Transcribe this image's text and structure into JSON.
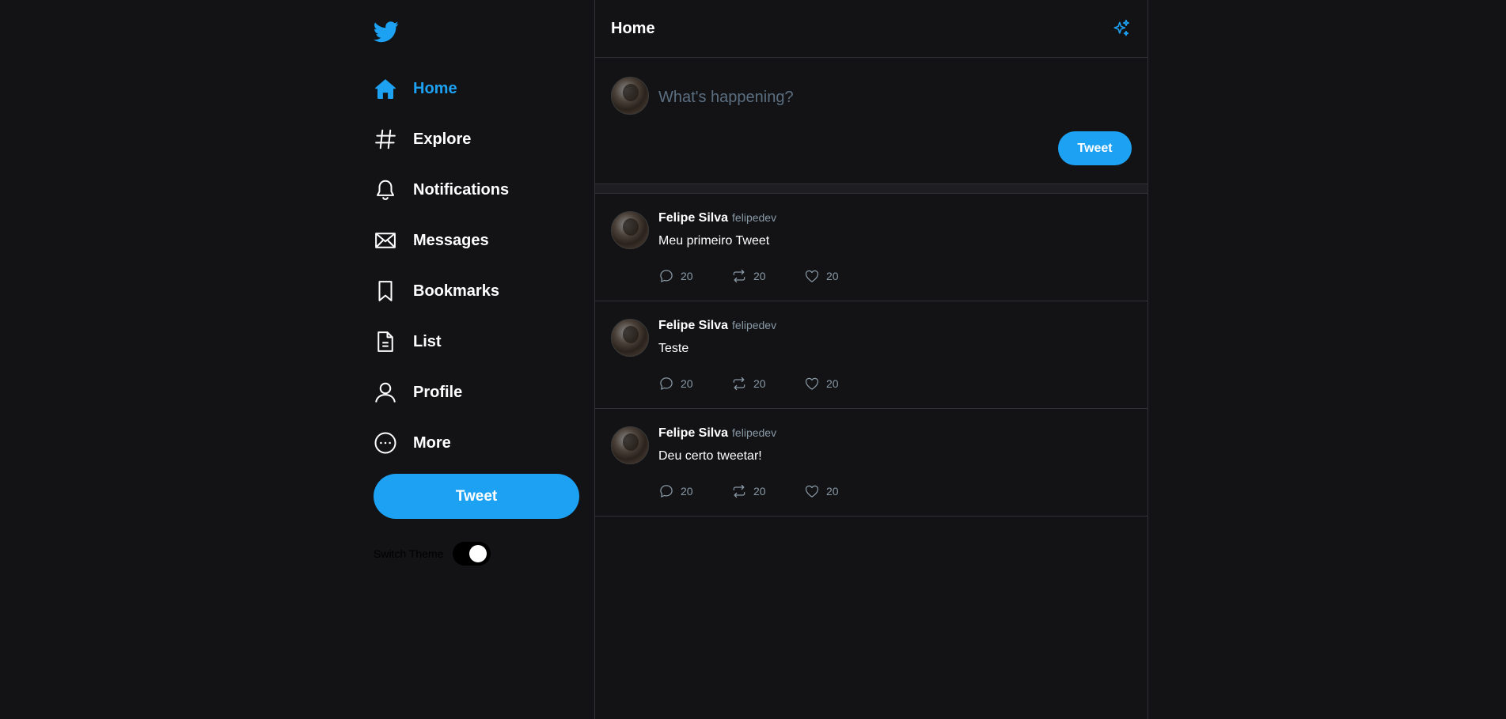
{
  "sidebar": {
    "logo": "twitter-bird-icon",
    "items": [
      {
        "label": "Home",
        "icon": "home-icon",
        "active": true
      },
      {
        "label": "Explore",
        "icon": "hash-icon"
      },
      {
        "label": "Notifications",
        "icon": "bell-icon"
      },
      {
        "label": "Messages",
        "icon": "envelope-icon"
      },
      {
        "label": "Bookmarks",
        "icon": "bookmark-icon"
      },
      {
        "label": "List",
        "icon": "list-document-icon"
      },
      {
        "label": "Profile",
        "icon": "user-icon"
      },
      {
        "label": "More",
        "icon": "more-circle-icon"
      }
    ],
    "tweet_label": "Tweet",
    "theme_label": "Switch Theme"
  },
  "header": {
    "title": "Home"
  },
  "composer": {
    "placeholder": "What's happening?",
    "tweet_label": "Tweet"
  },
  "tweets": [
    {
      "name": "Felipe Silva",
      "handle": "felipedev",
      "text": "Meu primeiro Tweet",
      "replies": "20",
      "retweets": "20",
      "likes": "20"
    },
    {
      "name": "Felipe Silva",
      "handle": "felipedev",
      "text": "Teste",
      "replies": "20",
      "retweets": "20",
      "likes": "20"
    },
    {
      "name": "Felipe Silva",
      "handle": "felipedev",
      "text": "Deu certo tweetar!",
      "replies": "20",
      "retweets": "20",
      "likes": "20"
    }
  ],
  "colors": {
    "accent": "#1da1f2",
    "background": "#131316",
    "muted": "#8899a6"
  }
}
